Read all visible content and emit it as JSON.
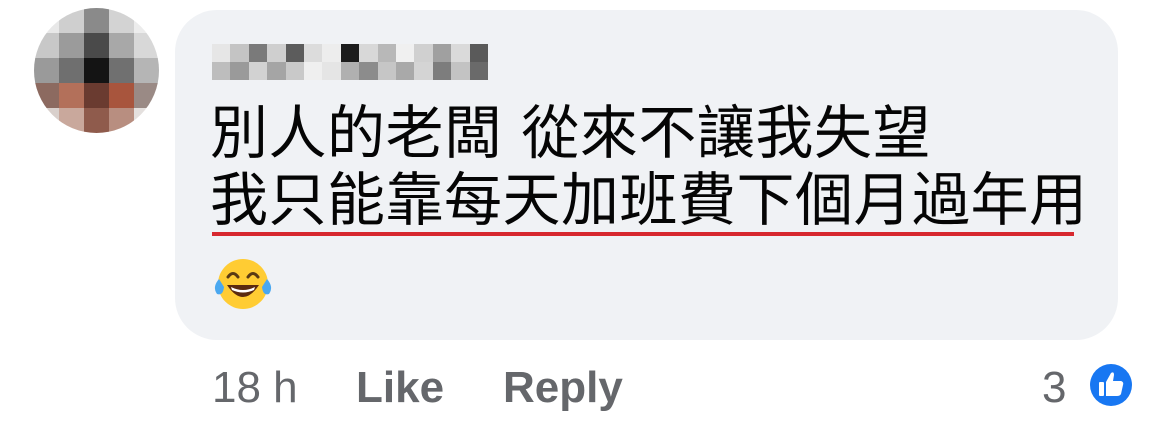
{
  "comment": {
    "author_name": "",
    "text_line_1": "別人的老闆 從來不讓我失望",
    "text_line_2": "我只能靠每天加班費下個月過年用",
    "emoji": "face-with-tears-of-joy"
  },
  "actions": {
    "time": "18 h",
    "like_label": "Like",
    "reply_label": "Reply"
  },
  "reactions": {
    "count": "3",
    "type": "like-icon",
    "color": "#1877f2"
  },
  "colors": {
    "bubble": "#f0f2f5",
    "text": "#050505",
    "meta": "#65676b",
    "underline": "#d7282f"
  }
}
